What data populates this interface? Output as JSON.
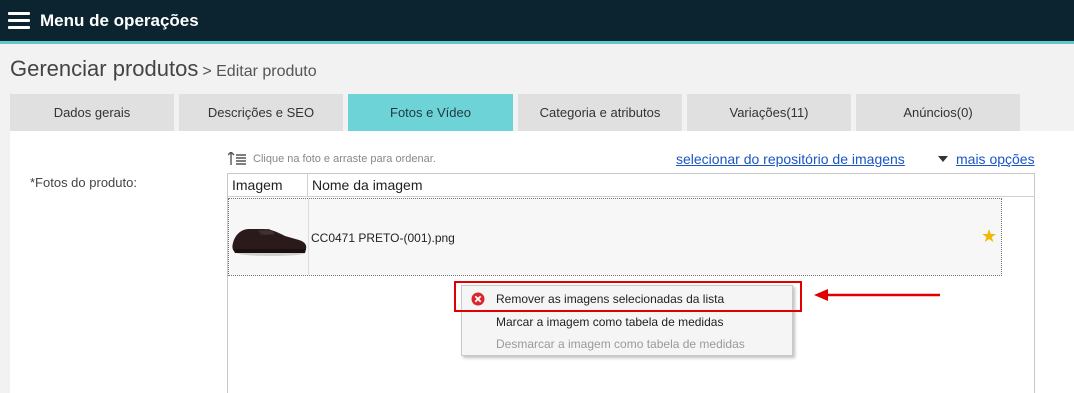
{
  "header": {
    "menu_title": "Menu de operações",
    "menu_icon": "hamburger-icon"
  },
  "page": {
    "title": "Gerenciar produtos",
    "breadcrumb": "> Editar produto"
  },
  "tabs": [
    {
      "label": "Dados gerais",
      "active": false
    },
    {
      "label": "Descrições e SEO",
      "active": false
    },
    {
      "label": "Fotos e Vídeo",
      "active": true
    },
    {
      "label": "Categoria e atributos",
      "active": false
    },
    {
      "label": "Variações(11)",
      "active": false
    },
    {
      "label": "Anúncios(0)",
      "active": false
    }
  ],
  "photos": {
    "field_label": "*Fotos do produto:",
    "hint": "Clique na foto e arraste para ordenar.",
    "repo_link": "selecionar do repositório de imagens",
    "more_options": "mais opções",
    "columns": [
      "Imagem",
      "Nome da imagem"
    ],
    "rows": [
      {
        "name": "CC0471 PRETO-(001).png",
        "starred": true
      }
    ]
  },
  "context_menu": {
    "items": [
      {
        "label": "Remover as imagens selecionadas da lista",
        "icon": "remove-icon",
        "enabled": true
      },
      {
        "label": "Marcar a imagem como tabela de medidas",
        "enabled": true
      },
      {
        "label": "Desmarcar a imagem como tabela de medidas",
        "enabled": false
      }
    ]
  },
  "colors": {
    "header_bg": "#0b2430",
    "accent": "#6dd3d6",
    "link": "#1a55c5",
    "highlight": "#e10000",
    "star": "#f3b800"
  }
}
